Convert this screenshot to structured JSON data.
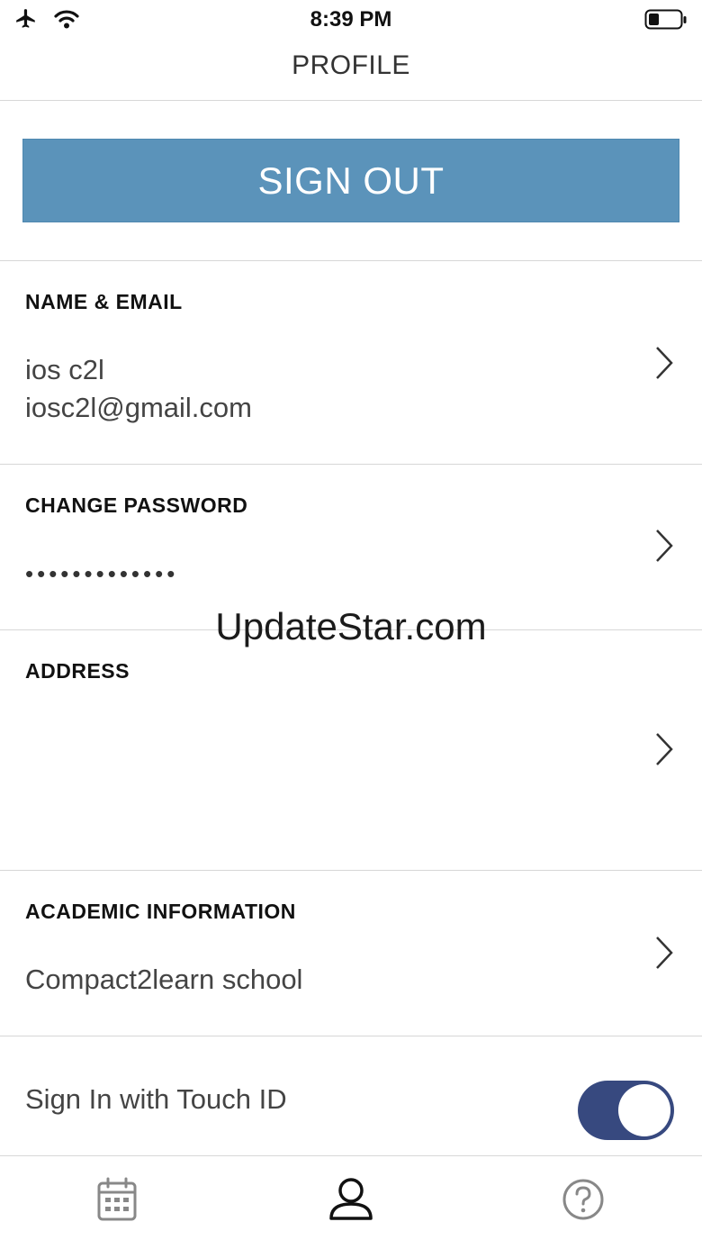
{
  "status_bar": {
    "time": "8:39 PM",
    "icons": [
      "airplane-icon",
      "wifi-icon",
      "battery-icon"
    ]
  },
  "header": {
    "title": "PROFILE"
  },
  "sign_out": {
    "label": "SIGN OUT"
  },
  "sections": {
    "name_email": {
      "heading": "NAME & EMAIL",
      "name": "ios c2l",
      "email": "iosc2l@gmail.com"
    },
    "password": {
      "heading": "CHANGE PASSWORD",
      "masked": "•••••••••••••"
    },
    "address": {
      "heading": "ADDRESS",
      "value": ""
    },
    "academic": {
      "heading": "ACADEMIC INFORMATION",
      "school": "Compact2learn school"
    }
  },
  "touch_id": {
    "label": "Sign In with Touch ID",
    "enabled": true
  },
  "tab_bar": {
    "tabs": [
      "calendar-icon",
      "profile-icon",
      "help-icon"
    ],
    "active": "profile-icon"
  },
  "watermark": {
    "text": "UpdateStar.com"
  },
  "colors": {
    "accent": "#5b93ba",
    "toggle_on": "#37497f",
    "divider": "#d7d7d7"
  }
}
